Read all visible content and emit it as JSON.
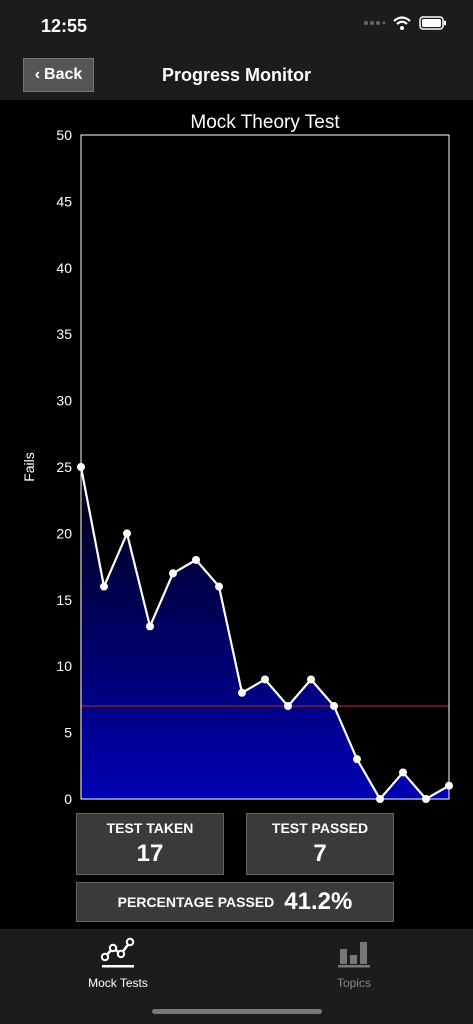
{
  "status": {
    "time": "12:55"
  },
  "nav": {
    "back_label": "Back",
    "title": "Progress Monitor"
  },
  "chart_data": {
    "type": "area",
    "title": "Mock Theory Test",
    "xlabel": "",
    "ylabel": "Fails",
    "ylim": [
      0,
      50
    ],
    "yticks": [
      0,
      5,
      10,
      15,
      20,
      25,
      30,
      35,
      40,
      45,
      50
    ],
    "x": [
      1,
      2,
      3,
      4,
      5,
      6,
      7,
      8,
      9,
      10,
      11,
      12,
      13,
      14,
      15,
      16,
      17
    ],
    "values": [
      25,
      16,
      20,
      13,
      17,
      18,
      16,
      8,
      9,
      7,
      9,
      7,
      3,
      0,
      2,
      0,
      1
    ],
    "threshold": 7,
    "grid": false,
    "colors": {
      "line": "#ffffff",
      "fill_top": "#000010",
      "fill_bottom": "#0000b4",
      "threshold": "#8b1a2e"
    }
  },
  "stats": {
    "taken_label": "TEST TAKEN",
    "taken_value": "17",
    "passed_label": "TEST PASSED",
    "passed_value": "7",
    "pct_label": "PERCENTAGE PASSED",
    "pct_value": "41.2%"
  },
  "tabs": [
    {
      "label": "Mock Tests",
      "icon": "line-chart-icon",
      "active": true
    },
    {
      "label": "Topics",
      "icon": "bar-chart-icon",
      "active": false
    }
  ]
}
